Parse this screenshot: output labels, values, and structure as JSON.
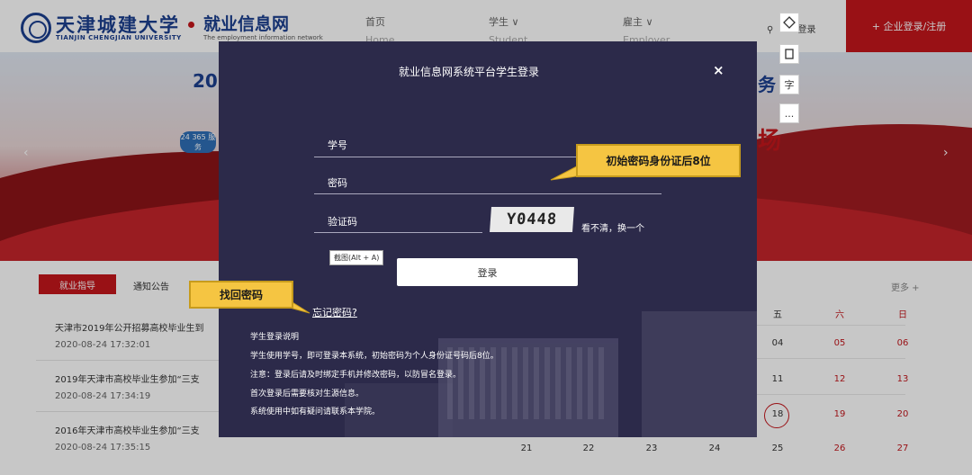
{
  "header": {
    "logo_cn": "天津城建大学",
    "logo_en": "TIANJIN CHENGJIAN UNIVERSITY",
    "site_title": "就业信息网",
    "site_sub": "The employment information network",
    "nav": [
      {
        "label": "首页",
        "en": "Home"
      },
      {
        "label": "学生 ∨",
        "en": "Student"
      },
      {
        "label": "雇主 ∨",
        "en": "Employer"
      }
    ],
    "login_label": "登录",
    "register_label": "+ 企业登录/注册"
  },
  "banner": {
    "title_left": "20",
    "title_right": "务",
    "red_text": "场",
    "badge": "24 365 服务"
  },
  "news": {
    "tab_active": "就业指导",
    "tab_other": "通知公告",
    "items": [
      {
        "title": "天津市2019年公开招募高校毕业生到",
        "date": "2020-08-24 17:32:01"
      },
      {
        "title": "2019年天津市高校毕业生参加“三支",
        "date": "2020-08-24 17:34:19"
      },
      {
        "title": "2016年天津市高校毕业生参加“三支",
        "date": "2020-08-24 17:35:15"
      }
    ]
  },
  "calendar": {
    "more": "更多 +",
    "headers": [
      "五",
      "六",
      "日"
    ],
    "rows": [
      [
        "04",
        "05",
        "06"
      ],
      [
        "11",
        "12",
        "13"
      ],
      [
        "18",
        "19",
        "20"
      ]
    ],
    "bottom_row": [
      "21",
      "22",
      "23",
      "24",
      "25",
      "26",
      "27"
    ]
  },
  "modal": {
    "title": "就业信息网系统平台学生登录",
    "close": "×",
    "student_id_label": "学号",
    "password_label": "密码",
    "captcha_label": "验证码",
    "captcha_text": "Y0448",
    "refresh_text": "看不清，换一个",
    "login_button": "登录",
    "forgot_link": "忘记密码?",
    "notes_title": "学生登录说明",
    "notes": [
      "学生使用学号，即可登录本系统，初始密码为个人身份证号码后8位。",
      "注意：登录后请及时绑定手机并修改密码，以防冒名登录。",
      "首次登录后需要核对生源信息。",
      "系统使用中如有疑问请联系本学院。"
    ]
  },
  "tooltip": "截图(Alt + A)",
  "callouts": {
    "password_hint": "初始密码身份证后8位",
    "recover": "找回密码"
  },
  "toolbar": {
    "icons": [
      "screenshot-icon",
      "copy-icon",
      "text-icon",
      "more-icon"
    ],
    "text_label": "字",
    "more_label": "..."
  },
  "colors": {
    "brand_blue": "#1c3f8f",
    "brand_red": "#c4161c",
    "modal_bg": "#2c2a4a",
    "callout": "#f5c542"
  }
}
